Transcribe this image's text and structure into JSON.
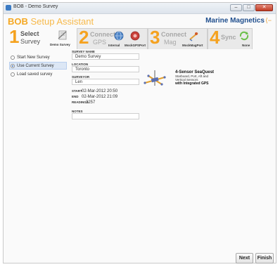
{
  "window": {
    "title": "BOB - Demo Survey",
    "controls": {
      "minimize": "–",
      "maximize": "□",
      "close": "✕"
    }
  },
  "header": {
    "brand": "BOB",
    "brand_rest": " Setup Assistant",
    "company": "Marine Magnetics",
    "colors": {
      "accent": "#f5a823",
      "company": "#1f4e8d"
    }
  },
  "steps": [
    {
      "num": "1",
      "line1": "Select",
      "line2": "Survey",
      "caption": "Demo Survey",
      "icon": "survey-icon"
    },
    {
      "num": "2",
      "line1": "Connect",
      "line2": "GPS",
      "caption1": "Internal",
      "caption2": "MockGPSPort",
      "icon1": "globe-icon",
      "icon2": "gps-icon"
    },
    {
      "num": "3",
      "line1": "Connect",
      "line2": "Mag",
      "caption": "MockMagPort",
      "icon": "magnetometer-icon"
    },
    {
      "num": "4",
      "line1": "Sync",
      "caption": "None",
      "icon": "sync-icon"
    }
  ],
  "sidebar": {
    "options": [
      {
        "label": "Start New Survey",
        "checked": false
      },
      {
        "label": "Use Current Survey",
        "checked": true
      },
      {
        "label": "Load saved survey",
        "checked": false
      }
    ]
  },
  "form": {
    "survey_name_label": "SURVEY NAME",
    "survey_name": "Demo Survey",
    "location_label": "LOCATION",
    "location": "Toronto",
    "surveyor_label": "SURVEYOR",
    "surveyor": "Len",
    "start_label": "START",
    "start": "02-Mar-2012 20:50",
    "end_label": "END",
    "end": "02-Mar-2012 21:09",
    "readings_label": "READINGS",
    "readings": "3257",
    "notes_label": "NOTES",
    "notes": ""
  },
  "device": {
    "title": "4-Sensor SeaQuest",
    "line1": "Starboard, Port, Aft and",
    "line2": "Vertical Sensors",
    "emph": "with Integrated GPS"
  },
  "buttons": {
    "next": "Next",
    "finish": "Finish"
  }
}
